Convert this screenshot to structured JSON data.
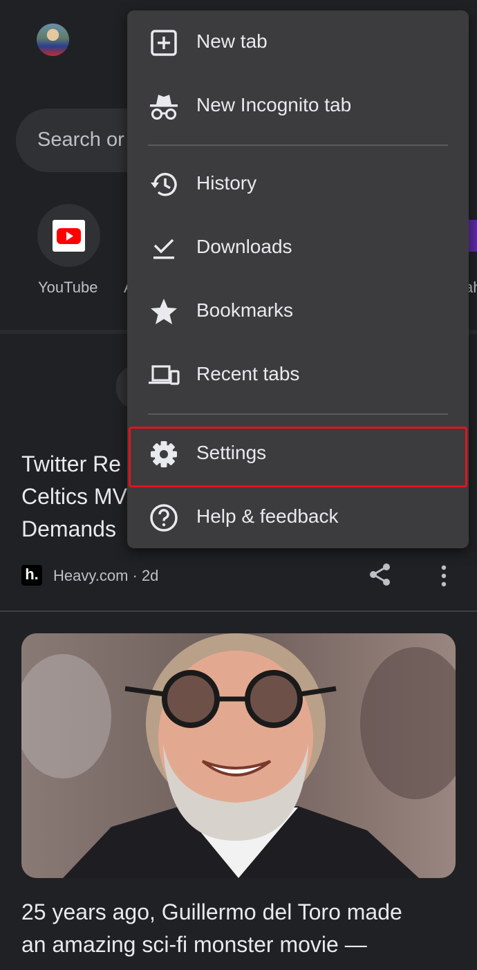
{
  "ntp": {
    "search_placeholder": "Search or",
    "shortcuts": [
      {
        "label": "YouTube",
        "icon": "youtube-icon"
      },
      {
        "label": "A"
      },
      {
        "label": "ah"
      }
    ]
  },
  "articles": [
    {
      "title_lines": [
        "Twitter Re",
        "Celtics MV",
        "Demands"
      ],
      "source_logo": "h.",
      "source": "Heavy.com · 2d"
    },
    {
      "title_lines": [
        "25 years ago, Guillermo del Toro made",
        "an amazing sci-fi monster movie —"
      ]
    }
  ],
  "menu": {
    "items": [
      {
        "label": "New tab",
        "icon": "new-tab-icon"
      },
      {
        "label": "New Incognito tab",
        "icon": "incognito-icon"
      },
      {
        "label": "History",
        "icon": "history-icon"
      },
      {
        "label": "Downloads",
        "icon": "downloads-icon"
      },
      {
        "label": "Bookmarks",
        "icon": "star-icon"
      },
      {
        "label": "Recent tabs",
        "icon": "devices-icon"
      },
      {
        "label": "Settings",
        "icon": "gear-icon"
      },
      {
        "label": "Help & feedback",
        "icon": "help-icon"
      }
    ],
    "highlighted_item": "Settings",
    "highlight_color": "#e3131b"
  },
  "colors": {
    "background": "#202124",
    "menu_background": "#3c3c3e",
    "youtube_red": "#ff0000"
  }
}
